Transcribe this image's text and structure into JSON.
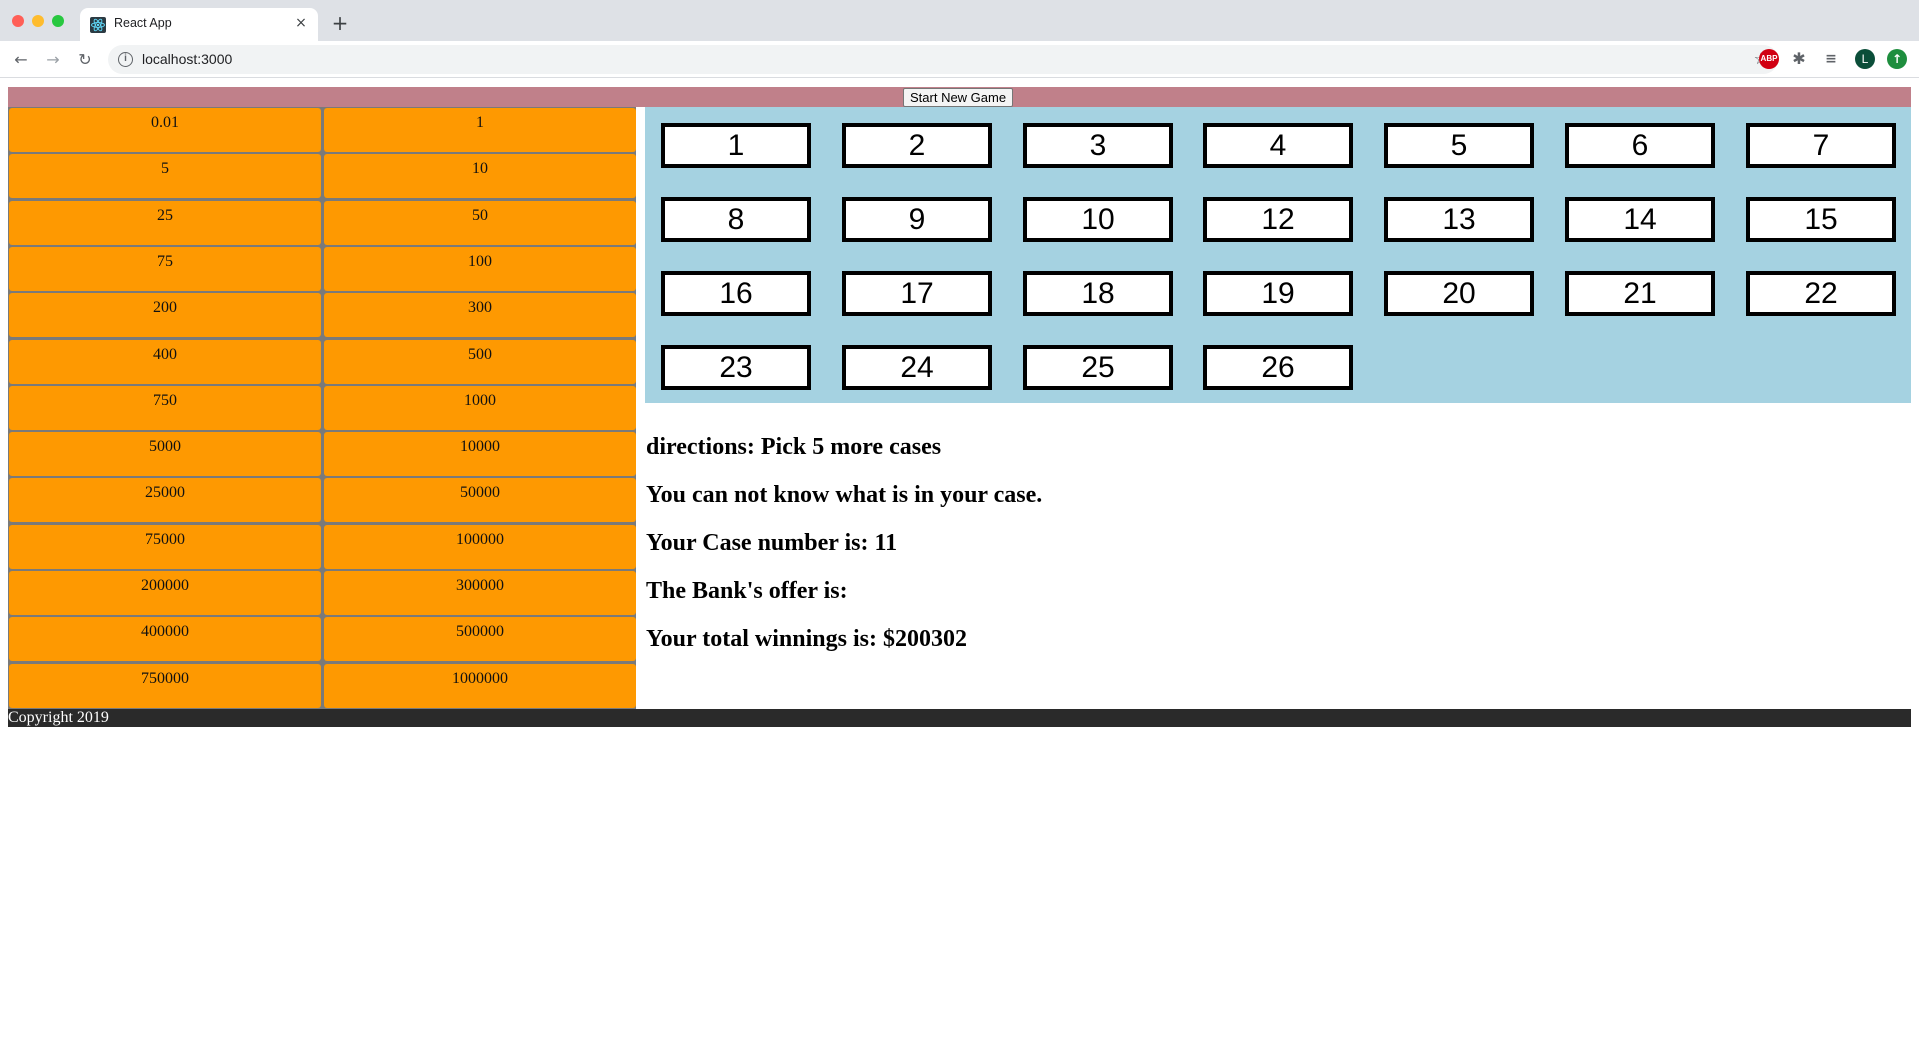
{
  "browser": {
    "tab_title": "React App",
    "tab_close": "×",
    "new_tab": "+",
    "url": "localhost:3000",
    "nav": {
      "back": "←",
      "forward": "→",
      "reload": "↻"
    },
    "icons": {
      "info": "i",
      "star": "☆",
      "abp": "ABP",
      "puzzle": "✱",
      "media": "≡",
      "avatar": "L",
      "update": "↑"
    },
    "colors": {
      "abp": "#d10012",
      "avatar": "#0b4e39",
      "update": "#1e8e3e"
    }
  },
  "app": {
    "start_button": "Start New Game",
    "money_values": [
      [
        "0.01",
        "1"
      ],
      [
        "5",
        "10"
      ],
      [
        "25",
        "50"
      ],
      [
        "75",
        "100"
      ],
      [
        "200",
        "300"
      ],
      [
        "400",
        "500"
      ],
      [
        "750",
        "1000"
      ],
      [
        "5000",
        "10000"
      ],
      [
        "25000",
        "50000"
      ],
      [
        "75000",
        "100000"
      ],
      [
        "200000",
        "300000"
      ],
      [
        "400000",
        "500000"
      ],
      [
        "750000",
        "1000000"
      ]
    ],
    "cases": [
      "1",
      "2",
      "3",
      "4",
      "5",
      "6",
      "7",
      "8",
      "9",
      "10",
      "12",
      "13",
      "14",
      "15",
      "16",
      "17",
      "18",
      "19",
      "20",
      "21",
      "22",
      "23",
      "24",
      "25",
      "26"
    ],
    "info": {
      "directions": "directions: Pick 5 more cases",
      "secret": "You can not know what is in your case.",
      "case_number": "Your Case number is: 11",
      "bank_offer": "The Bank's offer is:",
      "winnings": "Your total winnings is: $200302"
    },
    "footer": "Copyright 2019",
    "colors": {
      "header": "#c0808a",
      "money_cell": "#fe9901",
      "money_panel": "#7a7a7a",
      "case_panel": "#a5d2e1",
      "footer": "#2a2a2a"
    }
  }
}
